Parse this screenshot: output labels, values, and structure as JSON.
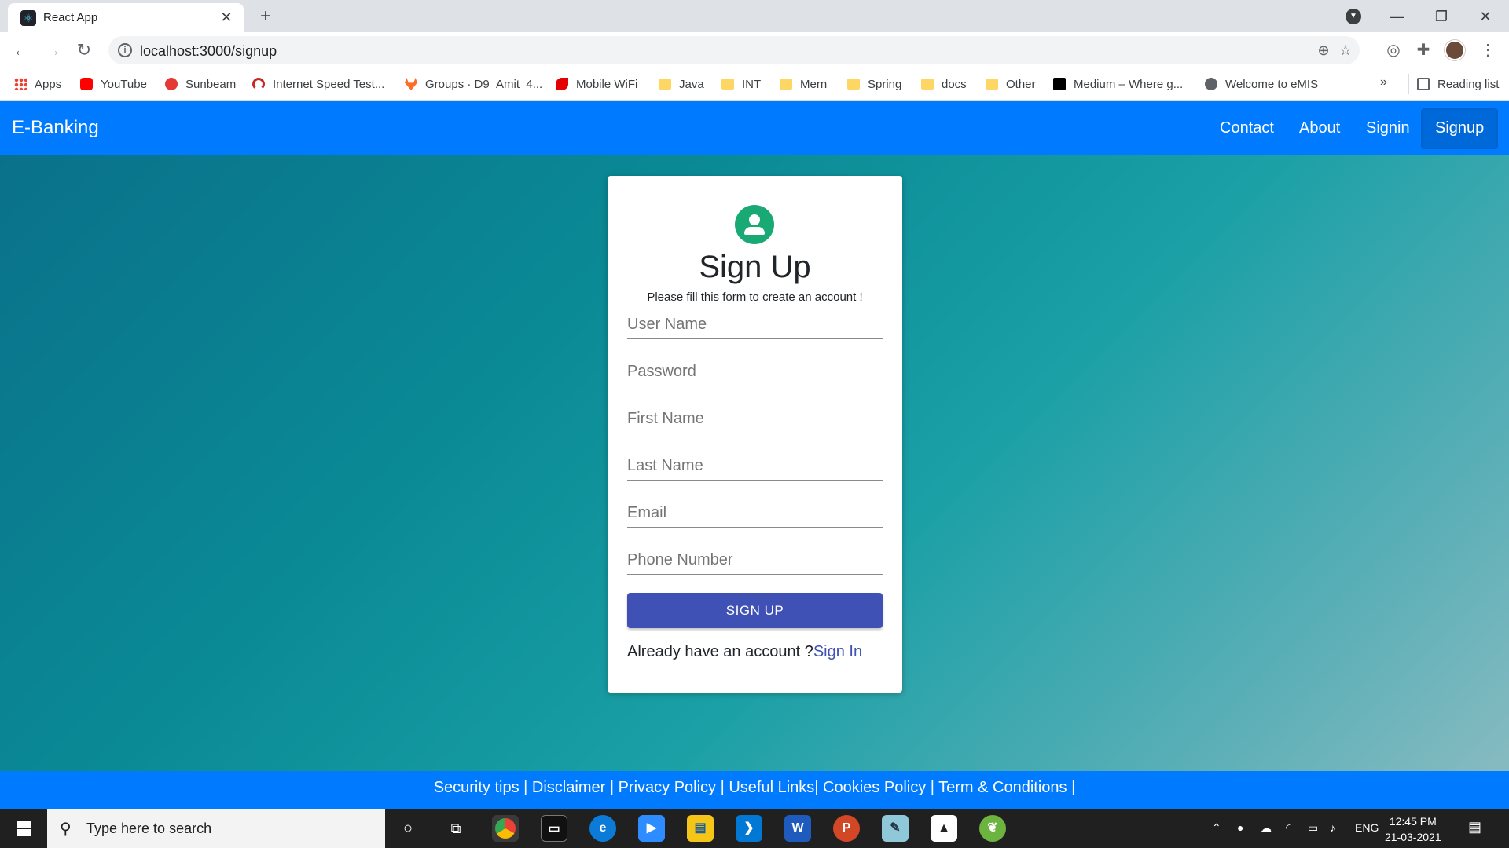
{
  "browser": {
    "tab_title": "React App",
    "tab_close": "✕",
    "new_tab": "+",
    "url": "localhost:3000/signup",
    "window_controls": {
      "minimize": "—",
      "maximize": "❐",
      "close": "✕"
    }
  },
  "bookmarks": [
    {
      "label": "Apps",
      "icon": "apps-grid-icon"
    },
    {
      "label": "YouTube",
      "icon": "youtube-icon",
      "color": "#ff0000"
    },
    {
      "label": "Sunbeam",
      "icon": "sunbeam-icon",
      "color": "#e53935"
    },
    {
      "label": "Internet Speed Test...",
      "icon": "speedtest-icon",
      "color": "#c62828"
    },
    {
      "label": "Groups · D9_Amit_4...",
      "icon": "gitlab-icon",
      "color": "#fc6d26"
    },
    {
      "label": "Mobile WiFi",
      "icon": "airtel-icon",
      "color": "#e40000"
    },
    {
      "label": "Java",
      "icon": "folder-icon"
    },
    {
      "label": "INT",
      "icon": "folder-icon"
    },
    {
      "label": "Mern",
      "icon": "folder-icon"
    },
    {
      "label": "Spring",
      "icon": "folder-icon"
    },
    {
      "label": "docs",
      "icon": "folder-icon"
    },
    {
      "label": "Other",
      "icon": "folder-icon"
    },
    {
      "label": "Medium – Where g...",
      "icon": "medium-icon",
      "color": "#000000"
    },
    {
      "label": "Welcome to eMIS",
      "icon": "globe-icon",
      "color": "#5f6368"
    }
  ],
  "bookmarks_more": "»",
  "reading_list": "Reading list",
  "navbar": {
    "brand": "E-Banking",
    "links": [
      "Contact",
      "About",
      "Signin",
      "Signup"
    ]
  },
  "form": {
    "title": "Sign Up",
    "subtitle": "Please fill this form to create an account !",
    "fields": [
      {
        "placeholder": "User Name"
      },
      {
        "placeholder": "Password"
      },
      {
        "placeholder": "First Name"
      },
      {
        "placeholder": "Last Name"
      },
      {
        "placeholder": "Email"
      },
      {
        "placeholder": "Phone Number"
      }
    ],
    "submit_label": "SIGN UP",
    "already_text": "Already have an account ?",
    "signin_link": "Sign In"
  },
  "footer": {
    "text": "Security tips | Disclaimer | Privacy Policy | Useful Links| Cookies Policy | Term & Conditions |"
  },
  "taskbar": {
    "search_placeholder": "Type here to search",
    "language": "ENG",
    "time": "12:45 PM",
    "date": "21-03-2021"
  },
  "colors": {
    "navbar": "#007bff",
    "button": "#3f51b5",
    "avatar": "#19a974"
  }
}
